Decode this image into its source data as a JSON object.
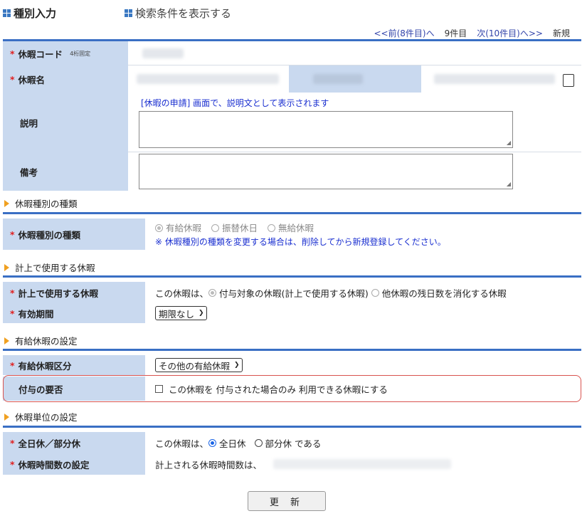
{
  "tabs": {
    "entry": "種別入力",
    "search": "検索条件を表示する"
  },
  "pager": {
    "prev": "<<前(8件目)へ",
    "current": "9件目",
    "next": "次(10件目)へ>>",
    "new": "新規"
  },
  "form": {
    "code_label": "休暇コード",
    "code_sub": "4桁固定",
    "name_label": "休暇名",
    "desc_label": "説明",
    "desc_note": "[休暇の申請] 画面で、説明文として表示されます",
    "remarks_label": "備考"
  },
  "sections": {
    "type": "休暇種別の種類",
    "usage": "計上で使用する休暇",
    "paid": "有給休暇の設定",
    "unit": "休暇単位の設定"
  },
  "type_row": {
    "label": "休暇種別の種類",
    "options": [
      "有給休暇",
      "振替休日",
      "無給休暇"
    ],
    "note": "※ 休暇種別の種類を変更する場合は、削除してから新規登録してください。"
  },
  "usage_row": {
    "label": "計上で使用する休暇",
    "prefix": "この休暇は、",
    "opt1": "付与対象の休暇(計上で使用する休暇)",
    "opt2": "他休暇の残日数を消化する休暇"
  },
  "validity_row": {
    "label": "有効期間",
    "value": "期限なし"
  },
  "paid_row": {
    "label": "有給休暇区分",
    "value": "その他の有給休暇"
  },
  "grant_row": {
    "label": "付与の要否",
    "text": "この休暇を 付与された場合のみ 利用できる休暇にする"
  },
  "unit_row": {
    "label": "全日休／部分休",
    "prefix": "この休暇は、",
    "opt1": "全日休",
    "opt2": "部分休",
    "suffix": "である"
  },
  "hours_row": {
    "label": "休暇時間数の設定",
    "text": "計上される休暇時間数は、"
  },
  "update_button": "更 新",
  "colors": {
    "accent_blue": "#3a6fc4",
    "label_bg": "#c9d9ef",
    "required": "#e02020",
    "highlight": "#d9534f",
    "note_blue": "#1a2fd0"
  }
}
